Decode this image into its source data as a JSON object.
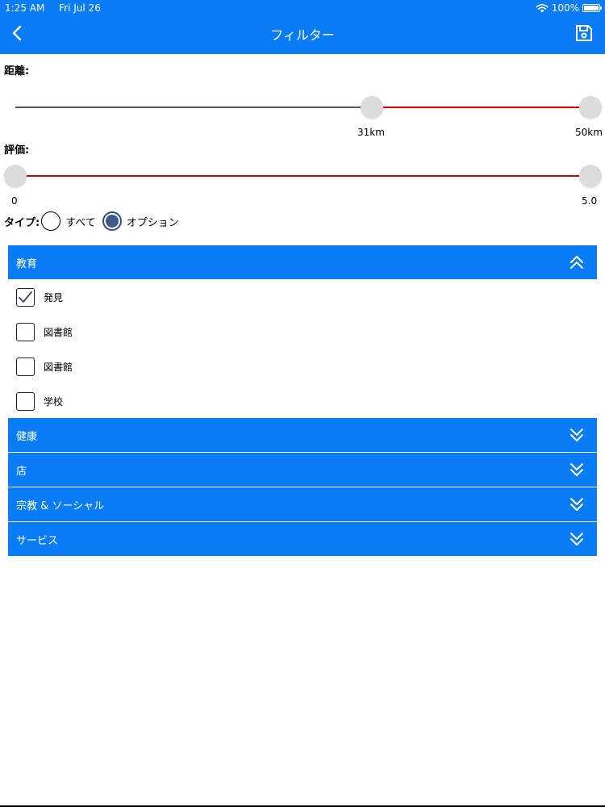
{
  "status_bar": {
    "time": "1:25 AM",
    "date": "Fri Jul 26",
    "battery": "100%"
  },
  "nav": {
    "title": "フィルター",
    "back_icon": "chevron-left-icon",
    "save_icon": "floppy-disk-icon"
  },
  "distance": {
    "label": "距離:",
    "min_value": "31km",
    "max_value": "50km",
    "range_km": [
      31,
      50
    ],
    "scale_max_km": 50
  },
  "rating": {
    "label": "評価:",
    "min_value": "0",
    "max_value": "5.0",
    "range": [
      0,
      5.0
    ],
    "scale_max": 5.0
  },
  "type": {
    "label": "タイプ:",
    "options": [
      {
        "label": "すべて",
        "selected": false
      },
      {
        "label": "オプション",
        "selected": true
      }
    ]
  },
  "sections": [
    {
      "title": "教育",
      "expanded": true,
      "items": [
        {
          "label": "発見",
          "checked": true
        },
        {
          "label": "図書館",
          "checked": false
        },
        {
          "label": "図書館",
          "checked": false
        },
        {
          "label": "学校",
          "checked": false
        }
      ]
    },
    {
      "title": "健康",
      "expanded": false
    },
    {
      "title": "店",
      "expanded": false
    },
    {
      "title": "宗教 & ソーシャル",
      "expanded": false
    },
    {
      "title": "サービス",
      "expanded": false
    }
  ],
  "colors": {
    "primary": "#0a7cf5",
    "track_selected": "#d40000",
    "track_unselected": "#555555",
    "thumb": "#dcdcdc",
    "radio_selected": "#3d5a88"
  }
}
